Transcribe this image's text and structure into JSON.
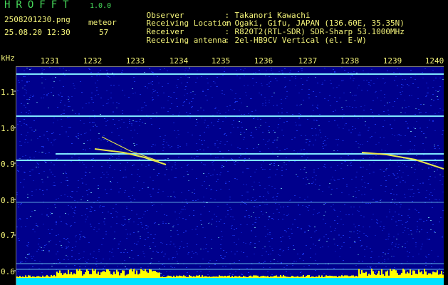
{
  "header": {
    "app_title": "HROFFT",
    "app_version": "1.0.0",
    "file_name": "2508201230.png",
    "meta_label": "meteor",
    "date_time": "25.08.20 12:30",
    "meteor_count": "57"
  },
  "station_info": [
    {
      "label": "Observer",
      "value": "Takanori Kawachi"
    },
    {
      "label": "Receiving Location",
      "value": "Ogaki, Gifu, JAPAN (136.60E, 35.35N)"
    },
    {
      "label": "Receiver",
      "value": "R820T2(RTL-SDR) SDR-Sharp 53.1000MHz"
    },
    {
      "label": "Receiving antenna",
      "value": "2el-HB9CV Vertical (el. E-W)"
    }
  ],
  "spectrogram": {
    "frequency_unit": "kHz",
    "frequency_ticks": [
      "1.1",
      "1.0",
      "0.9",
      "0.8",
      "0.7",
      "0.6"
    ],
    "time_ticks": [
      "1231",
      "1232",
      "1233",
      "1234",
      "1235",
      "1236",
      "1237",
      "1238",
      "1239",
      "1240"
    ],
    "colors": {
      "background": "#00008c",
      "noise": "#1e3cff",
      "signal": "#7fe6ff",
      "meteor": "#e8e84a",
      "activity_bar": "#ffff00",
      "baseline": "#00e0ff"
    }
  }
}
